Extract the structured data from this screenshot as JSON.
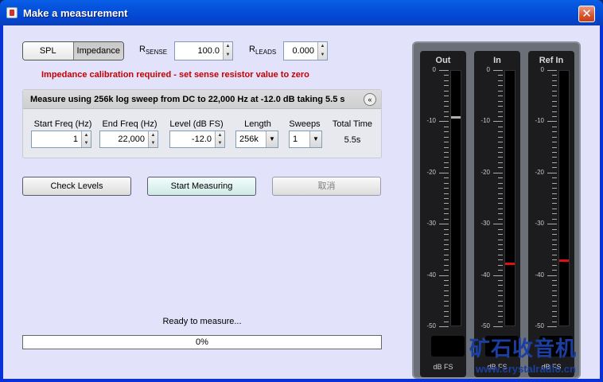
{
  "window": {
    "title": "Make a measurement",
    "close": "✕"
  },
  "mode": {
    "spl_label": "SPL",
    "impedance_label": "Impedance",
    "selected": "Impedance"
  },
  "rsense": {
    "label_main": "R",
    "label_sub": "SENSE",
    "value": "100.0"
  },
  "rleads": {
    "label_main": "R",
    "label_sub": "LEADS",
    "value": "0.000"
  },
  "warning": "Impedance calibration required - set sense resistor value to zero",
  "measure_panel": {
    "title": "Measure using  256k log sweep from DC to 22,000 Hz at -12.0 dB taking 5.5 s",
    "collapse_icon": "«",
    "headers": {
      "start_freq": "Start Freq (Hz)",
      "end_freq": "End Freq (Hz)",
      "level": "Level (dB FS)",
      "length": "Length",
      "sweeps": "Sweeps",
      "total_time": "Total Time"
    },
    "values": {
      "start_freq": "1",
      "end_freq": "22,000",
      "level": "-12.0",
      "length": "256k",
      "sweeps": "1",
      "total_time": "5.5s"
    }
  },
  "buttons": {
    "check_levels": "Check Levels",
    "start_measuring": "Start Measuring",
    "cancel": "取消"
  },
  "status": "Ready to measure...",
  "progress": {
    "percent": 0,
    "label": "0%"
  },
  "meters": [
    {
      "title": "Out",
      "scale": [
        "0",
        "-10",
        "-20",
        "-30",
        "-40",
        "-50"
      ],
      "unit": "dB FS",
      "level_db": -9,
      "marker_color": "#b0b0b0"
    },
    {
      "title": "In",
      "scale": [
        "0",
        "-10",
        "-20",
        "-30",
        "-40",
        "-50"
      ],
      "unit": "dB FS",
      "level_db": -37.5,
      "marker_color": "#e01010"
    },
    {
      "title": "Ref In",
      "scale": [
        "0",
        "-10",
        "-20",
        "-30",
        "-40",
        "-50"
      ],
      "unit": "dB FS",
      "level_db": -37,
      "marker_color": "#e01010"
    }
  ],
  "watermark": {
    "text": "矿石收音机",
    "url": "www.crystalradio.cn"
  }
}
